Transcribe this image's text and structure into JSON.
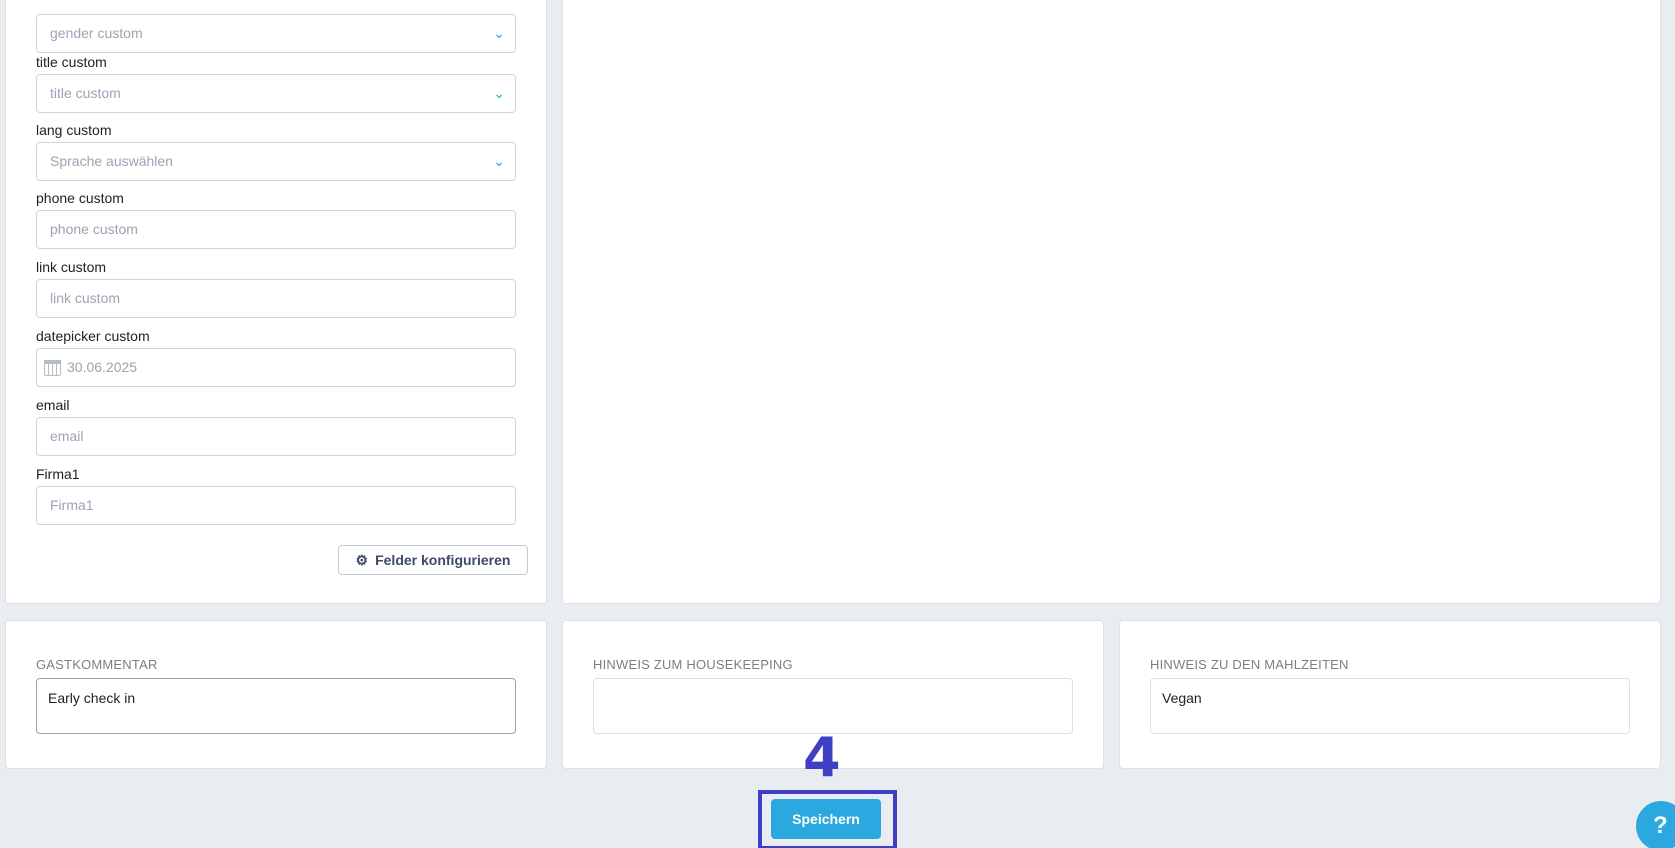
{
  "fields": [
    {
      "label": "",
      "type": "select",
      "placeholder": "gender custom"
    },
    {
      "label": "title custom",
      "type": "select",
      "placeholder": "title custom"
    },
    {
      "label": "lang custom",
      "type": "select",
      "placeholder": "Sprache auswählen"
    },
    {
      "label": "phone custom",
      "type": "text",
      "placeholder": "phone custom"
    },
    {
      "label": "link custom",
      "type": "text",
      "placeholder": "link custom"
    },
    {
      "label": "datepicker custom",
      "type": "date",
      "placeholder": "30.06.2025"
    },
    {
      "label": "email",
      "type": "text",
      "placeholder": "email"
    },
    {
      "label": "Firma1",
      "type": "text",
      "placeholder": "Firma1"
    }
  ],
  "config_button": {
    "label": "Felder konfigurieren",
    "icon": "gear-icon"
  },
  "comments": {
    "guest": {
      "title": "GASTKOMMENTAR",
      "value": "Early check in"
    },
    "housekeeping": {
      "title": "HINWEIS ZUM HOUSEKEEPING",
      "value": ""
    },
    "meals": {
      "title": "HINWEIS ZU DEN MAHLZEITEN",
      "value": "Vegan"
    }
  },
  "annotation": {
    "step": "4"
  },
  "save_button": {
    "label": "Speichern"
  },
  "help_button": {
    "label": "?"
  },
  "colors": {
    "accent": "#2aa8df",
    "annotation": "#3f3fc4",
    "background": "#e9ecf1"
  }
}
